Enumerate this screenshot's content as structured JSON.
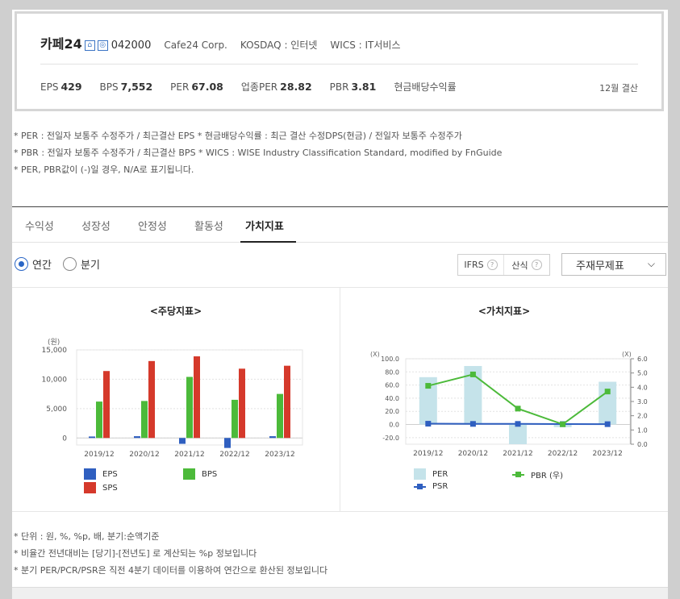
{
  "header": {
    "corp_name": "카페24",
    "home_icon_glyph": "⌂",
    "ir_icon_glyph": "◎",
    "code": "042000",
    "english_name": "Cafe24 Corp.",
    "market": "KOSDAQ : 인터넷",
    "wics": "WICS : IT서비스",
    "ratios": [
      {
        "label": "EPS",
        "value": "429"
      },
      {
        "label": "BPS",
        "value": "7,552"
      },
      {
        "label": "PER",
        "value": "67.08"
      },
      {
        "label": "업종PER",
        "value": "28.82"
      },
      {
        "label": "PBR",
        "value": "3.81"
      },
      {
        "label": "현금배당수익률",
        "value": ""
      }
    ],
    "settlement": "12월 결산"
  },
  "notes": [
    "* PER : 전일자 보통주 수정주가 / 최근결산 EPS * 현금배당수익률 : 최근 결산 수정DPS(현금) / 전일자 보통주 수정주가",
    "* PBR : 전일자 보통주 수정주가 / 최근결산 BPS * WICS : WISE Industry Classification Standard, modified by FnGuide",
    "* PER, PBR값이 (-)일 경우, N/A로 표기됩니다."
  ],
  "tabs": [
    "수익성",
    "성장성",
    "안정성",
    "활동성",
    "가치지표"
  ],
  "active_tab": "가치지표",
  "period": {
    "annual": "연간",
    "quarterly": "분기"
  },
  "buttons": {
    "ifrs": "IFRS",
    "formula": "산식",
    "help_glyph": "?"
  },
  "dropdown": {
    "selected": "주재무제표",
    "chevron": "⌵"
  },
  "chart_data": [
    {
      "type": "bar",
      "title": "<주당지표>",
      "unit_label": "(원)",
      "categories": [
        "2019/12",
        "2020/12",
        "2021/12",
        "2022/12",
        "2023/12"
      ],
      "ylim": [
        -1200,
        15000
      ],
      "y_ticks": [
        0,
        5000,
        10000,
        15000
      ],
      "y_tick_labels": [
        "0",
        "5,000",
        "10,000",
        "15,000"
      ],
      "grid": true,
      "legend_position": "bottom",
      "series": [
        {
          "name": "EPS",
          "color": "#2f5fc0",
          "values": [
            250,
            300,
            -1000,
            -1700,
            300
          ]
        },
        {
          "name": "BPS",
          "color": "#4cba3a",
          "values": [
            6200,
            6300,
            10400,
            6500,
            7500
          ]
        },
        {
          "name": "SPS",
          "color": "#d5392b",
          "values": [
            11400,
            13100,
            13900,
            11800,
            12300
          ]
        }
      ]
    },
    {
      "type": "bar",
      "title": "<가치지표>",
      "unit_left": "(X)",
      "unit_right": "(X)",
      "categories": [
        "2019/12",
        "2020/12",
        "2021/12",
        "2022/12",
        "2023/12"
      ],
      "ylim_left": [
        -30,
        100
      ],
      "y_ticks_left": [
        -20,
        0,
        20,
        40,
        60,
        80,
        100
      ],
      "y_tick_labels_left": [
        "-20.0",
        "0.0",
        "20.0",
        "40.0",
        "60.0",
        "80.0",
        "100.0"
      ],
      "ylim_right": [
        0,
        6
      ],
      "y_ticks_right": [
        0,
        1,
        2,
        3,
        4,
        5,
        6
      ],
      "y_tick_labels_right": [
        "0.0",
        "1.0",
        "2.0",
        "3.0",
        "4.0",
        "5.0",
        "6.0"
      ],
      "grid": true,
      "legend_position": "bottom",
      "series": [
        {
          "name": "PER",
          "kind": "bar",
          "axis": "left",
          "color": "#c5e3ea",
          "values": [
            72,
            89,
            -30,
            -4,
            65
          ]
        },
        {
          "name": "PBR (우)",
          "kind": "line",
          "axis": "right",
          "color": "#4cba3a",
          "values": [
            4.1,
            4.9,
            2.5,
            1.4,
            3.7
          ]
        },
        {
          "name": "PSR",
          "kind": "line",
          "axis": "left",
          "color": "#2f5fc0",
          "values": [
            1.2,
            0.9,
            0.9,
            0.6,
            0.5
          ]
        }
      ]
    }
  ],
  "foot_notes": [
    "* 단위 : 원, %, %p, 배, 분기:순액기준",
    "* 비율간 전년대비는 [당기]-[전년도] 로 계산되는 %p 정보입니다",
    "* 분기 PER/PCR/PSR은 직전 4분기 데이터를 이용하여 연간으로 환산된 정보입니다"
  ]
}
